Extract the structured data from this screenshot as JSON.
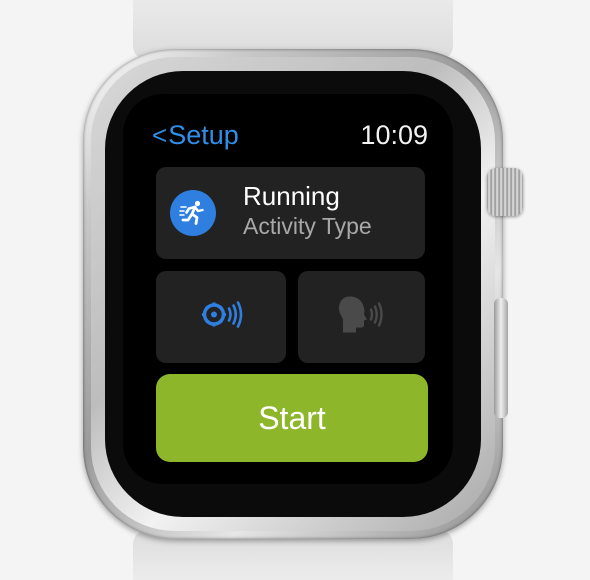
{
  "header": {
    "back_chevron": "<",
    "back_label": "Setup",
    "time": "10:09"
  },
  "activity": {
    "title": "Running",
    "subtitle": "Activity Type",
    "icon": "running-figure-icon"
  },
  "options": [
    {
      "icon": "heart-rate-sensor-icon",
      "state": "active"
    },
    {
      "icon": "voice-feedback-icon",
      "state": "inactive"
    }
  ],
  "start_button": {
    "label": "Start"
  },
  "colors": {
    "accent_blue": "#2f8fe8",
    "start_green": "#8db62a",
    "card_bg": "#222222",
    "inactive_icon": "#4a4a4a",
    "subtitle_gray": "#a8a8a8"
  }
}
